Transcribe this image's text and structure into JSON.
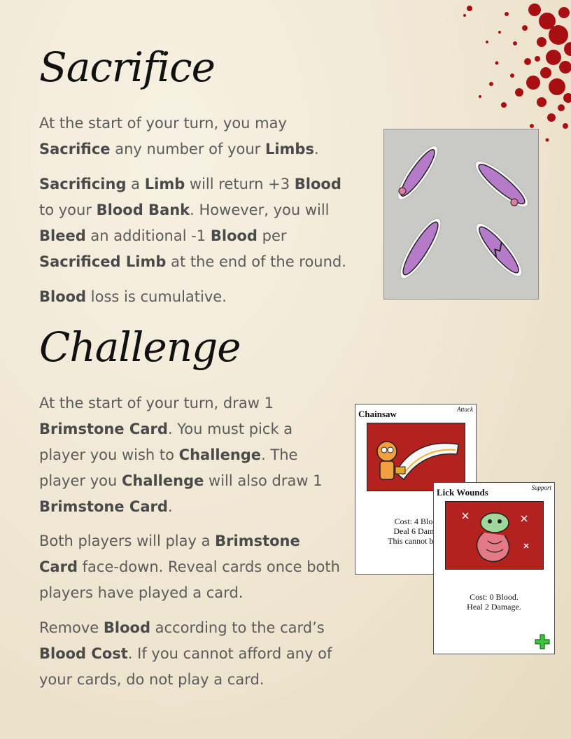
{
  "sections": [
    {
      "heading": "Sacrifice",
      "paragraphs": [
        [
          {
            "t": "At the start of your turn, you may "
          },
          {
            "t": "Sacrifice",
            "b": true
          },
          {
            "t": " any number of your "
          },
          {
            "t": "Limbs",
            "b": true
          },
          {
            "t": "."
          }
        ],
        [
          {
            "t": "Sacrificing",
            "b": true
          },
          {
            "t": " a "
          },
          {
            "t": "Limb",
            "b": true
          },
          {
            "t": " will return +3 "
          },
          {
            "t": "Blood",
            "b": true
          },
          {
            "t": " to your "
          },
          {
            "t": "Blood Bank",
            "b": true
          },
          {
            "t": ". However, you will "
          },
          {
            "t": "Bleed",
            "b": true
          },
          {
            "t": " an additional -1 "
          },
          {
            "t": "Blood",
            "b": true
          },
          {
            "t": " per "
          },
          {
            "t": "Sacrificed Limb",
            "b": true
          },
          {
            "t": " at the end of the round."
          }
        ],
        [
          {
            "t": "Blood",
            "b": true
          },
          {
            "t": " loss is cumulative."
          }
        ]
      ]
    },
    {
      "heading": "Challenge",
      "paragraphs": [
        [
          {
            "t": "At the start of your turn, draw 1 "
          },
          {
            "t": "Brimstone Card",
            "b": true
          },
          {
            "t": ". You must pick a player you wish to "
          },
          {
            "t": "Challenge",
            "b": true
          },
          {
            "t": ". The player you "
          },
          {
            "t": "Challenge",
            "b": true
          },
          {
            "t": " will also draw 1 "
          },
          {
            "t": "Brimstone Card",
            "b": true
          },
          {
            "t": "."
          }
        ],
        [
          {
            "t": "Both players will play a "
          },
          {
            "t": "Brimstone Card",
            "b": true
          },
          {
            "t": " face-down. Reveal cards once both players have played a card."
          }
        ],
        [
          {
            "t": "Remove "
          },
          {
            "t": "Blood",
            "b": true
          },
          {
            "t": " according to the card’s "
          },
          {
            "t": "Blood Cost",
            "b": true
          },
          {
            "t": ". If you cannot afford any of your cards, do not play a card."
          }
        ]
      ]
    }
  ],
  "cards": {
    "chainsaw": {
      "name": "Chainsaw",
      "type": "Attack",
      "lines": [
        "Cost: 4 Bloo",
        "Deal 6 Dama",
        "This cannot be d"
      ]
    },
    "lick_wounds": {
      "name": "Lick Wounds",
      "type": "Support",
      "lines": [
        "Cost: 0 Blood.",
        "Heal 2 Damage."
      ]
    }
  },
  "colors": {
    "blood_red": "#a80f12",
    "card_art_red": "#b3221f",
    "heal_green": "#3cc43c",
    "limb_purple": "#b57bc9"
  }
}
